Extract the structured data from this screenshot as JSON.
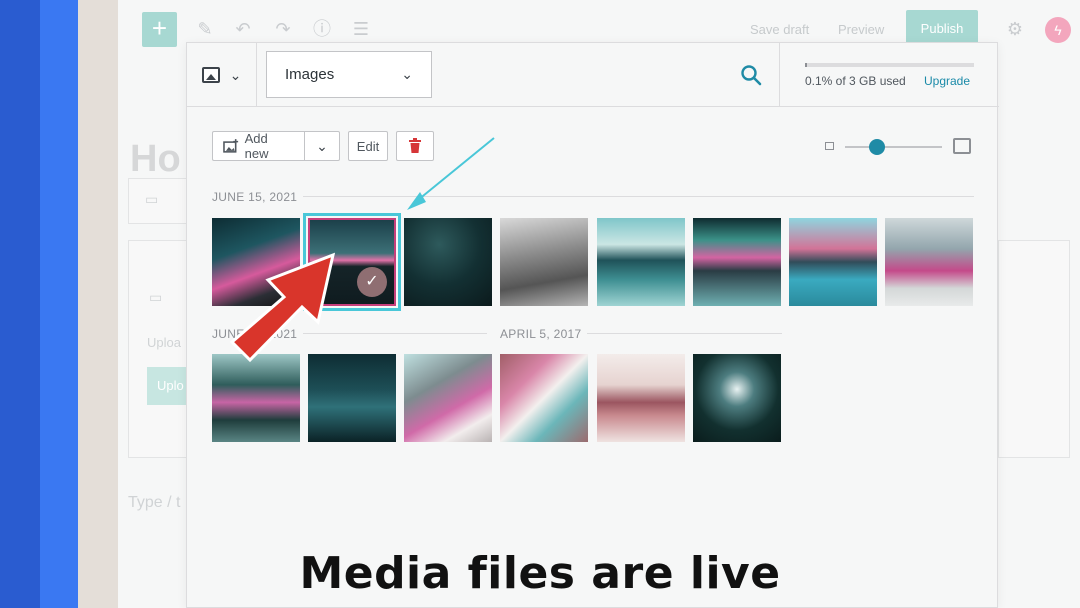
{
  "editor": {
    "add_symbol": "+",
    "links": {
      "save_draft": "Save draft",
      "preview": "Preview"
    },
    "publish_label": "Publish",
    "title_fragment": "Ho",
    "upload_fragment": "Uploa",
    "upload_button_fragment": "Uplo",
    "type_fragment": "Type / t"
  },
  "modal": {
    "filter": {
      "selected": "Images"
    },
    "storage": {
      "used_text": "0.1% of 3 GB used",
      "upgrade_label": "Upgrade",
      "used_fraction": 0.001
    },
    "toolbar": {
      "add_new_label": "Add new",
      "edit_label": "Edit"
    },
    "groups": [
      {
        "label": "JUNE 15, 2021"
      },
      {
        "label": "JUNE 15, 2021"
      },
      {
        "label": "APRIL 5, 2017"
      }
    ]
  },
  "overlay": {
    "caption": "Media files are live",
    "annotation_arrow_color": "#d9352b",
    "pointer_line_color": "#49c7d8"
  },
  "colors": {
    "accent": "#1f8ba6",
    "publish_bg": "#a7d8d2",
    "delete_red": "#d63638",
    "selection_outline": "#49c7d8"
  }
}
